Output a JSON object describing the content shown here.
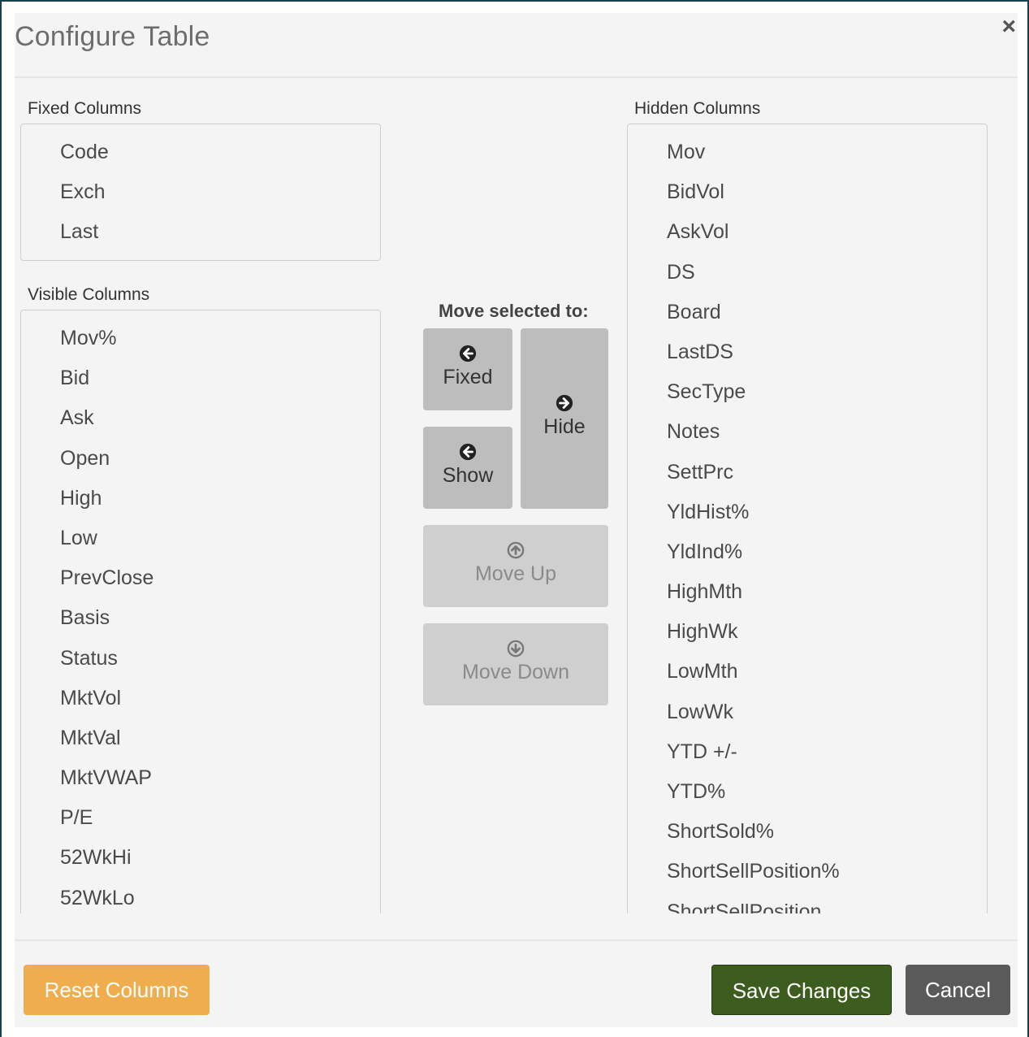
{
  "dialog": {
    "title": "Configure Table",
    "close_symbol": "×"
  },
  "fixed_columns": {
    "label": "Fixed Columns",
    "items": [
      "Code",
      "Exch",
      "Last"
    ]
  },
  "visible_columns": {
    "label": "Visible Columns",
    "items": [
      "Mov%",
      "Bid",
      "Ask",
      "Open",
      "High",
      "Low",
      "PrevClose",
      "Basis",
      "Status",
      "MktVol",
      "MktVal",
      "MktVWAP",
      "P/E",
      "52WkHi",
      "52WkLo"
    ]
  },
  "hidden_columns": {
    "label": "Hidden Columns",
    "items": [
      "Mov",
      "BidVol",
      "AskVol",
      "DS",
      "Board",
      "LastDS",
      "SecType",
      "Notes",
      "SettPrc",
      "YldHist%",
      "YldInd%",
      "HighMth",
      "HighWk",
      "LowMth",
      "LowWk",
      "YTD +/-",
      "YTD%",
      "ShortSold%",
      "ShortSellPosition%",
      "ShortSellPosition"
    ]
  },
  "move_controls": {
    "label": "Move selected to:",
    "fixed": "Fixed",
    "show": "Show",
    "hide": "Hide",
    "move_up": "Move Up",
    "move_down": "Move Down"
  },
  "footer": {
    "reset": "Reset Columns",
    "save": "Save Changes",
    "cancel": "Cancel"
  },
  "colors": {
    "reset": "#f0ad4e",
    "save": "#3c5d1e",
    "cancel": "#5a5a5a",
    "backdrop": "#16404f"
  },
  "icons": {
    "fixed": "arrow-circle-left-icon",
    "show": "arrow-circle-left-icon",
    "hide": "arrow-circle-right-icon",
    "move_up": "arrow-circle-up-icon",
    "move_down": "arrow-circle-down-icon",
    "close": "close-icon"
  }
}
